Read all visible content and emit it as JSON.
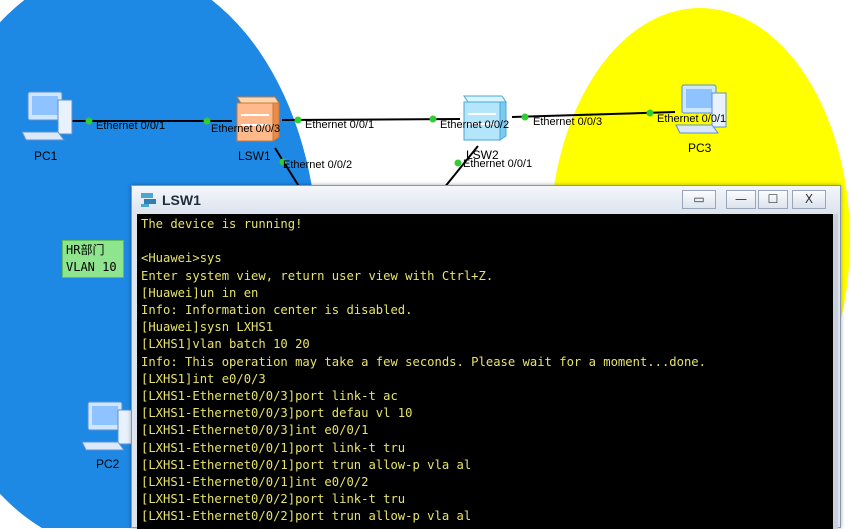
{
  "topology": {
    "devices": {
      "pc1": "PC1",
      "pc2": "PC2",
      "pc3": "PC3",
      "lsw1": "LSW1",
      "lsw2": "LSW2"
    },
    "ports": {
      "pc1_side": "Ethernet 0/0/1",
      "lsw1_e003": "Ethernet 0/0/3",
      "lsw1_e001": "Ethernet 0/0/1",
      "lsw1_e002": "Ethernet 0/0/2",
      "lsw2_e002": "Ethernet 0/0/2",
      "lsw2_e003": "Ethernet 0/0/3",
      "lsw2_e001": "Ethernet 0/0/1",
      "pc3_side": "Ethernet 0/0/1"
    },
    "hr_label": {
      "line1": "HR部门",
      "line2": "VLAN 10"
    },
    "colors": {
      "blue_zone": "#1e88e5",
      "yellow_zone": "#ffff00",
      "link_dot": "#33cc33"
    }
  },
  "window": {
    "title": "LSW1",
    "buttons": {
      "restore": "▭",
      "minimize": "—",
      "maximize": "☐",
      "close": "X"
    },
    "terminal_lines": [
      "The device is running!",
      "",
      "<Huawei>sys",
      "Enter system view, return user view with Ctrl+Z.",
      "[Huawei]un in en",
      "Info: Information center is disabled.",
      "[Huawei]sysn LXHS1",
      "[LXHS1]vlan batch 10 20",
      "Info: This operation may take a few seconds. Please wait for a moment...done.",
      "[LXHS1]int e0/0/3",
      "[LXHS1-Ethernet0/0/3]port link-t ac",
      "[LXHS1-Ethernet0/0/3]port defau vl 10",
      "[LXHS1-Ethernet0/0/3]int e0/0/1",
      "[LXHS1-Ethernet0/0/1]port link-t tru",
      "[LXHS1-Ethernet0/0/1]port trun allow-p vla al",
      "[LXHS1-Ethernet0/0/1]int e0/0/2",
      "[LXHS1-Ethernet0/0/2]port link-t tru",
      "[LXHS1-Ethernet0/0/2]port trun allow-p vla al"
    ]
  }
}
